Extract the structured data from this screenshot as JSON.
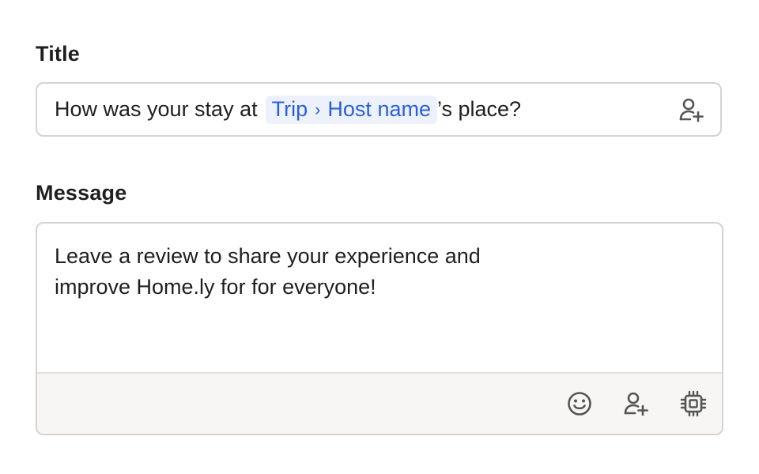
{
  "title_field": {
    "label": "Title",
    "text_before": "How was your stay at",
    "variable": {
      "parent": "Trip",
      "separator": "›",
      "child": "Host name"
    },
    "text_after": "’s place?",
    "icon": "person-add-icon"
  },
  "message_field": {
    "label": "Message",
    "value": "Leave a review to share your experience and\nimprove Home.ly for for everyone!",
    "toolbar": {
      "icons": [
        "emoji-icon",
        "person-add-icon",
        "chip-icon"
      ]
    }
  },
  "colors": {
    "chip_background": "#ecf1fb",
    "chip_text": "#2b5fd9",
    "border": "#d6d3d0",
    "toolbar_background": "#f7f6f4",
    "icon": "#555555"
  }
}
